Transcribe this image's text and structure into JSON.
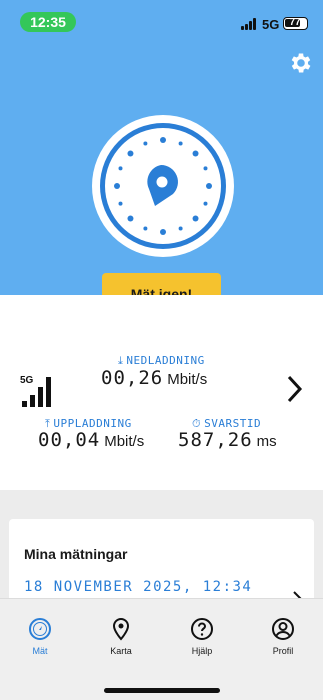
{
  "status_bar": {
    "time": "12:35",
    "network": "5G",
    "battery": "77",
    "battery_level": 0.77
  },
  "header": {
    "settings_icon": "gear-icon",
    "gauge_icon": "speedometer-gauge-icon"
  },
  "actions": {
    "retry_label": "Mät igen!"
  },
  "results": {
    "network_badge": "5G",
    "download": {
      "label": "NEDLADDNING",
      "value": "00,26",
      "unit": "Mbit/s"
    },
    "upload": {
      "label": "UPPLADDNING",
      "value": "00,04",
      "unit": "Mbit/s"
    },
    "latency": {
      "label": "SVARSTID",
      "value": "587,26",
      "unit": "ms"
    }
  },
  "measurements_card": {
    "title": "Mina mätningar",
    "date": "18 NOVEMBER 2025, 12:34"
  },
  "nav": {
    "items": [
      {
        "label": "Mät",
        "icon": "speedometer-icon",
        "active": true
      },
      {
        "label": "Karta",
        "icon": "map-pin-icon",
        "active": false
      },
      {
        "label": "Hjälp",
        "icon": "help-icon",
        "active": false
      },
      {
        "label": "Profil",
        "icon": "profile-icon",
        "active": false
      }
    ]
  },
  "colors": {
    "hero": "#5faef0",
    "accent": "#2a7ed6",
    "button": "#f5c22e",
    "status_pill": "#34c759"
  }
}
